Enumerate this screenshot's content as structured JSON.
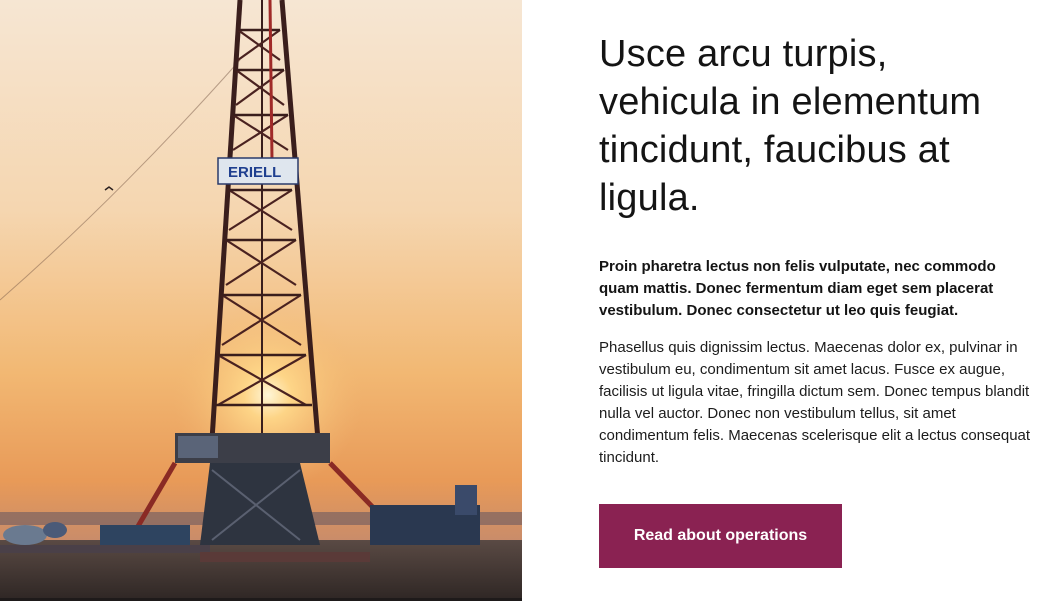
{
  "hero_image": {
    "alt_subject": "drilling-rig-at-sunset",
    "sign_text": "ERIELL"
  },
  "content": {
    "heading": "Usce arcu turpis, vehicula in elementum tincidunt, faucibus at ligula.",
    "lead": "Proin pharetra lectus non felis vulputate, nec commodo quam mattis. Donec fermentum diam eget sem placerat vestibulum. Donec consectetur ut leo quis feugiat.",
    "body": "Phasellus quis dignissim lectus. Maecenas dolor ex, pulvinar in vestibulum eu, condimentum sit amet lacus. Fusce ex augue, facilisis ut ligula vitae, fringilla dictum sem. Donec tempus blandit nulla vel auctor. Donec non vestibulum tellus, sit amet condimentum felis. Maecenas scelerisque elit a lectus consequat tincidunt.",
    "cta_label": "Read about operations"
  },
  "colors": {
    "accent": "#8a2252",
    "text": "#141414",
    "background": "#ffffff"
  }
}
